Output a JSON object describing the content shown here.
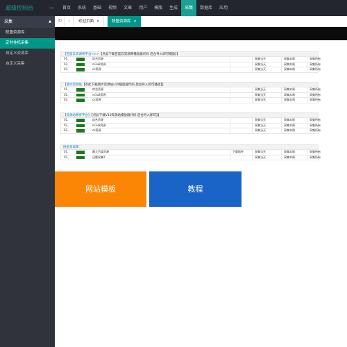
{
  "app": {
    "brand": "超级控制台",
    "collapse_icon": "minus-icon"
  },
  "nav": [
    "首页",
    "系统",
    "基础",
    "视频",
    "文章",
    "用户",
    "模版",
    "生成",
    "采集",
    "数据库",
    "应用"
  ],
  "nav_active_index": 8,
  "sidebar": {
    "header": "采集",
    "items": [
      {
        "label": "联盟资源库",
        "state": "plain"
      },
      {
        "label": "定时挂机采集",
        "state": "active"
      },
      {
        "label": "自定义资源库",
        "state": "normal"
      },
      {
        "label": "自定义采集",
        "state": "normal"
      }
    ]
  },
  "tabs": {
    "refresh_icon": "refresh-icon",
    "back_icon": "chevron-left-icon",
    "items": [
      {
        "label": "欢迎页面",
        "active": false
      },
      {
        "label": "联盟资源库",
        "active": true
      }
    ]
  },
  "sections": [
    {
      "site": "【百度云资源明平台>>>",
      "hint": "【点此下载百度云资源网播放器代码 后台导入即可播放】】",
      "rows": [
        {
          "num": "01、",
          "name": "综合资源",
          "mid": "",
          "a": "采集当天",
          "b": "采集本周",
          "c": "采集所有"
        },
        {
          "num": "02、",
          "name": "m3u8资源",
          "mid": "",
          "a": "采集当天",
          "b": "采集本周",
          "c": "采集所有"
        },
        {
          "num": "03、",
          "name": "ck资源",
          "mid": "",
          "a": "采集当天",
          "b": "采集本周",
          "c": "采集所有"
        }
      ]
    },
    {
      "site": "【期大资源站",
      "hint": "【点此下载期大资源站v10播放器代码 后台导入即可播放】】",
      "rows": [
        {
          "num": "01、",
          "name": "综合资源",
          "mid": "",
          "a": "采集当天",
          "b": "采集本周",
          "c": "采集所有"
        },
        {
          "num": "02、",
          "name": "m3u8资源",
          "mid": "",
          "a": "采集当天",
          "b": "采集本周",
          "c": "采集所有"
        },
        {
          "num": "03、",
          "name": "ck资源",
          "mid": "",
          "a": "采集当天",
          "b": "采集本周",
          "c": "采集所有"
        }
      ]
    },
    {
      "site": "【资源站教育平台】",
      "hint": "【点此下载V10资源站播放器代码 后台导入即可】】",
      "rows": [
        {
          "num": "01、",
          "name": "综合资源",
          "mid": "",
          "a": "采集当天",
          "b": "采集本周",
          "c": "采集所有"
        },
        {
          "num": "02、",
          "name": "m3u8资源",
          "mid": "",
          "a": "采集当天",
          "b": "采集本周",
          "c": "采集所有"
        },
        {
          "num": "03、",
          "name": "ck资源",
          "mid": "",
          "a": "采集当天",
          "b": "采集本周",
          "c": "采集所有"
        }
      ]
    },
    {
      "site": "拼星资源库",
      "hint": "",
      "rows": [
        {
          "num": "01、",
          "name": "最大百度资源",
          "mid": "下载插件",
          "a": "采集当天",
          "b": "采集本周",
          "c": "采集所有"
        },
        {
          "num": "02、",
          "name": "迅雷采集2",
          "mid": "",
          "a": "采集当天",
          "b": "采集本周",
          "c": "采集所有"
        }
      ]
    }
  ],
  "banners": [
    {
      "label": "网站模板",
      "color": "#fb8605"
    },
    {
      "label": "教程",
      "color": "#1a64c8"
    }
  ]
}
